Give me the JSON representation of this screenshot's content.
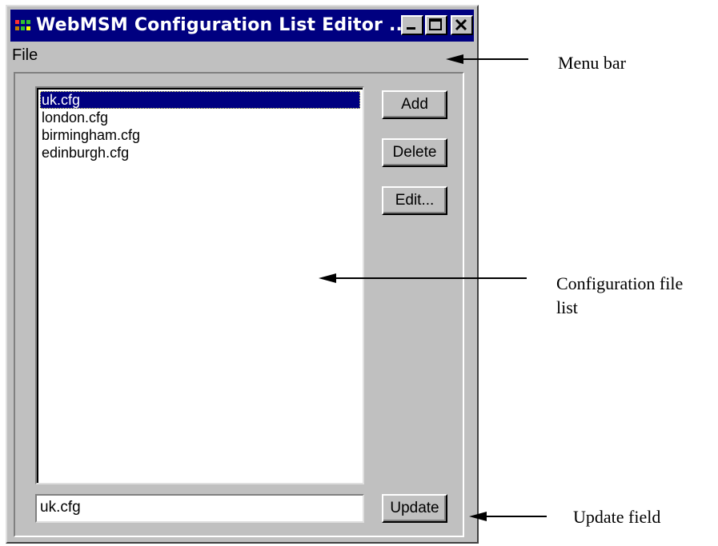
{
  "window": {
    "title": "WebMSM Configuration List Editor ...",
    "menu": {
      "file": "File"
    },
    "config_list": {
      "items": [
        "uk.cfg",
        "london.cfg",
        "birmingham.cfg",
        "edinburgh.cfg"
      ],
      "selected_index": 0
    },
    "buttons": {
      "add": "Add",
      "delete": "Delete",
      "edit": "Edit...",
      "update": "Update"
    },
    "update_field": {
      "value": "uk.cfg"
    }
  },
  "annotations": {
    "menu_bar": "Menu bar",
    "config_list_line1": "Configuration file",
    "config_list_line2": "list",
    "update_field": "Update field"
  },
  "colors": {
    "titlebar": "#000080",
    "window_face": "#c0c0c0",
    "selection": "#000080"
  }
}
